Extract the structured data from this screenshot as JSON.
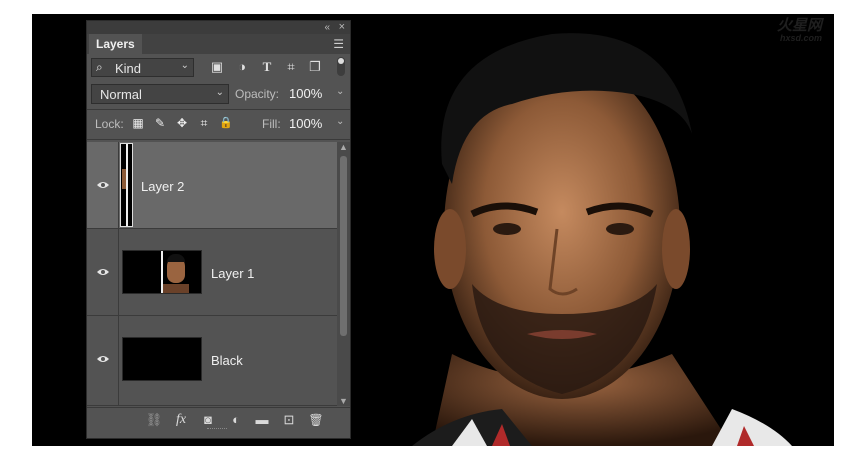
{
  "watermark": {
    "logo": "火星网",
    "url": "hxsd.com"
  },
  "panel": {
    "collapse_glyph": "«",
    "close_glyph": "×",
    "tab": "Layers",
    "menu_icon": "panel-menu-icon",
    "filter": {
      "glyph": "⌕",
      "value": "Kind",
      "arrow": "⌄"
    },
    "filter_icons": [
      {
        "name": "pixel-layer-filter-icon",
        "glyph": "▣"
      },
      {
        "name": "adjustment-layer-filter-icon",
        "glyph": "◑"
      },
      {
        "name": "type-layer-filter-icon",
        "glyph": "T"
      },
      {
        "name": "shape-layer-filter-icon",
        "glyph": "⌗"
      },
      {
        "name": "smart-object-filter-icon",
        "glyph": "❐"
      }
    ],
    "blend_mode": "Normal",
    "opacity_label": "Opacity:",
    "opacity_value": "100%",
    "lock_label": "Lock:",
    "lock_icons": [
      {
        "name": "lock-transparent-pixels-icon",
        "glyph": "▦"
      },
      {
        "name": "lock-image-pixels-icon",
        "glyph": "✎"
      },
      {
        "name": "lock-position-icon",
        "glyph": "✥"
      },
      {
        "name": "lock-artboard-icon",
        "glyph": "⌗"
      },
      {
        "name": "lock-all-icon",
        "glyph": "🔒"
      }
    ],
    "fill_label": "Fill:",
    "fill_value": "100%",
    "dropdown_arrow": "⌄",
    "layers": [
      {
        "name": "Layer 2",
        "selected": true
      },
      {
        "name": "Layer 1",
        "selected": false
      },
      {
        "name": "Black",
        "selected": false
      }
    ],
    "bottom_icons": [
      {
        "name": "link-layers-icon",
        "glyph": "⛓"
      },
      {
        "name": "add-layer-style-icon",
        "glyph": "fx"
      },
      {
        "name": "add-layer-mask-icon",
        "glyph": "◙"
      },
      {
        "name": "new-adjustment-layer-icon",
        "glyph": "◐"
      },
      {
        "name": "new-group-icon",
        "glyph": "▬"
      },
      {
        "name": "new-layer-icon",
        "glyph": "⊡"
      },
      {
        "name": "delete-layer-icon",
        "glyph": "🗑"
      }
    ]
  },
  "colors": {
    "panel_bg": "#535353",
    "selected_layer": "#696969",
    "canvas": "#000000"
  }
}
